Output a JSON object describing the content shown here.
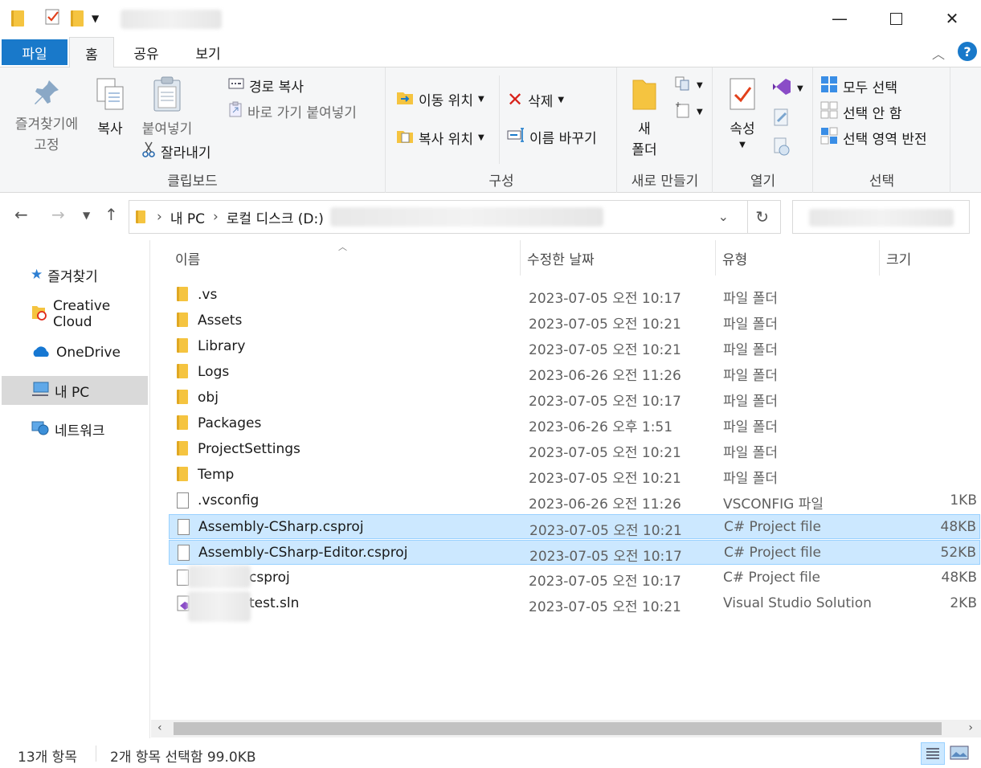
{
  "ribbon_tabs": {
    "file": "파일",
    "home": "홈",
    "share": "공유",
    "view": "보기"
  },
  "clipboard": {
    "pin_line1": "즐겨찾기에",
    "pin_line2": "고정",
    "copy": "복사",
    "paste": "붙여넣기",
    "copy_path": "경로 복사",
    "paste_shortcut": "바로 가기 붙여넣기",
    "cut": "잘라내기",
    "label": "클립보드"
  },
  "organize": {
    "move_to": "이동 위치",
    "copy_to": "복사 위치",
    "delete": "삭제",
    "rename": "이름 바꾸기",
    "label": "구성"
  },
  "new": {
    "new_folder_line1": "새",
    "new_folder_line2": "폴더",
    "label": "새로 만들기"
  },
  "open": {
    "properties": "속성",
    "label": "열기"
  },
  "select": {
    "select_all": "모두 선택",
    "select_none": "선택 안 함",
    "invert": "선택 영역 반전",
    "label": "선택"
  },
  "address": {
    "crumb1": "내 PC",
    "crumb2": "로컬 디스크 (D:)"
  },
  "nav": {
    "favorites": "즐겨찾기",
    "creative_cloud": "Creative Cloud",
    "onedrive": "OneDrive",
    "this_pc": "내 PC",
    "network": "네트워크"
  },
  "columns": {
    "name": "이름",
    "date": "수정한 날짜",
    "type": "유형",
    "size": "크기"
  },
  "files": [
    {
      "name": ".vs",
      "date": "2023-07-05 오전 10:17",
      "type": "파일 폴더",
      "size": "",
      "kind": "folder"
    },
    {
      "name": "Assets",
      "date": "2023-07-05 오전 10:21",
      "type": "파일 폴더",
      "size": "",
      "kind": "folder"
    },
    {
      "name": "Library",
      "date": "2023-07-05 오전 10:21",
      "type": "파일 폴더",
      "size": "",
      "kind": "folder"
    },
    {
      "name": "Logs",
      "date": "2023-06-26 오전 11:26",
      "type": "파일 폴더",
      "size": "",
      "kind": "folder"
    },
    {
      "name": "obj",
      "date": "2023-07-05 오전 10:17",
      "type": "파일 폴더",
      "size": "",
      "kind": "folder"
    },
    {
      "name": "Packages",
      "date": "2023-06-26 오후 1:51",
      "type": "파일 폴더",
      "size": "",
      "kind": "folder"
    },
    {
      "name": "ProjectSettings",
      "date": "2023-07-05 오전 10:21",
      "type": "파일 폴더",
      "size": "",
      "kind": "folder"
    },
    {
      "name": "Temp",
      "date": "2023-07-05 오전 10:21",
      "type": "파일 폴더",
      "size": "",
      "kind": "folder"
    },
    {
      "name": ".vsconfig",
      "date": "2023-06-26 오전 11:26",
      "type": "VSCONFIG 파일",
      "size": "1KB",
      "kind": "doc"
    },
    {
      "name": "Assembly-CSharp.csproj",
      "date": "2023-07-05 오전 10:21",
      "type": "C# Project file",
      "size": "48KB",
      "kind": "doc"
    },
    {
      "name": "Assembly-CSharp-Editor.csproj",
      "date": "2023-07-05 오전 10:17",
      "type": "C# Project file",
      "size": "52KB",
      "kind": "doc"
    },
    {
      "name": "csproj",
      "date": "2023-07-05 오전 10:17",
      "type": "C# Project file",
      "size": "48KB",
      "kind": "doc"
    },
    {
      "name": "test.sln",
      "date": "2023-07-05 오전 10:21",
      "type": "Visual Studio Solution",
      "size": "2KB",
      "kind": "sln"
    }
  ],
  "status": {
    "count": "13개 항목",
    "selected": "2개 항목 선택함 99.0KB"
  },
  "colors": {
    "accent": "#1979ca",
    "selection": "#cce8ff",
    "folder": "#f5c440"
  }
}
